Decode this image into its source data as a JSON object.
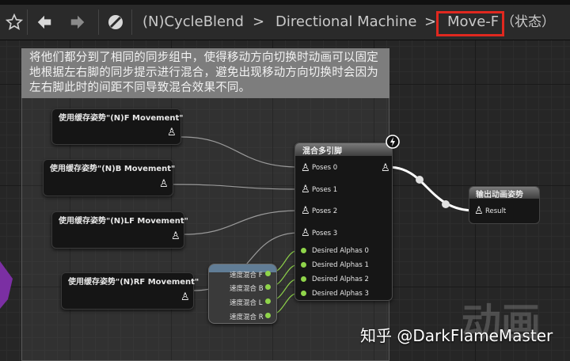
{
  "toolbar": {
    "breadcrumbs": [
      "(N)CycleBlend",
      "Directional Machine",
      "Move-F"
    ],
    "state_suffix": "（状态）",
    "separator": ">"
  },
  "comment": {
    "text": "将他们都分到了相同的同步组中，使得移动方向切换时动画可以固定地根据左右脚的同步提示进行混合，避免出现移动方向切换时会因为左右脚此时的间距不同导致混合效果不同。"
  },
  "cached_pose_nodes": [
    {
      "title": "使用缓存姿势\"(N)F Movement\""
    },
    {
      "title": "使用缓存姿势\"(N)B Movement\""
    },
    {
      "title": "使用缓存姿势\"(N)LF Movement\""
    },
    {
      "title": "使用缓存姿势\"(N)RF Movement\""
    }
  ],
  "blend_node": {
    "title": "混合多引脚",
    "pose_pins": [
      "Poses 0",
      "Poses 1",
      "Poses 2",
      "Poses 3"
    ],
    "alpha_pins": [
      "Desired Alphas 0",
      "Desired Alphas 1",
      "Desired Alphas 2",
      "Desired Alphas 3"
    ]
  },
  "speed_node": {
    "pins": [
      "速度混合 F",
      "速度混合 B",
      "速度混合 L",
      "速度混合 R"
    ]
  },
  "output_node": {
    "title": "输出动画姿势",
    "pin": "Result"
  },
  "watermark": "知乎 @DarkFlameMaster",
  "ghost_text": "动画",
  "icons": [
    "star-icon",
    "back-arrow-icon",
    "forward-arrow-icon",
    "blocked-icon",
    "lightning-icon",
    "pose-person-icon"
  ],
  "colors": {
    "highlight_box": "#e0281f",
    "alpha_pin": "#8fd44a",
    "toolbar_bg": "#2a2a2a"
  }
}
